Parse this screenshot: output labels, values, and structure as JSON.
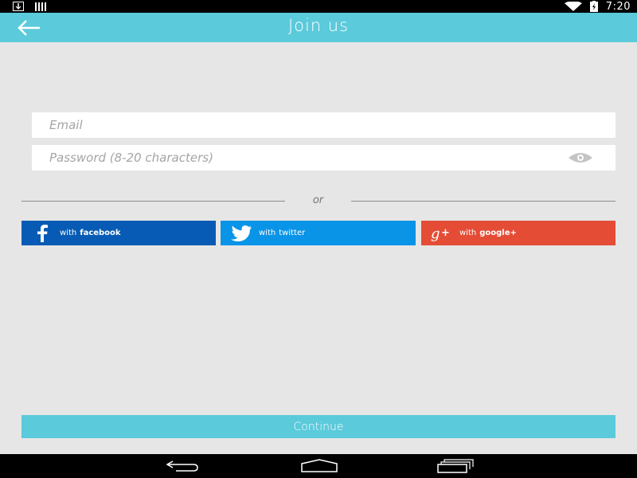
{
  "status_bar": {
    "time": "7:20",
    "left_icons": [
      "download-icon",
      "bars-icon"
    ],
    "right_icons": [
      "wifi-icon",
      "battery-charging-icon"
    ]
  },
  "app_bar": {
    "title": "Join us",
    "back_icon": "arrow-left-icon",
    "background": "#5bcadb"
  },
  "form": {
    "email_placeholder": "Email",
    "password_placeholder": "Password (8-20 characters)",
    "password_toggle_icon": "eye-icon"
  },
  "divider": {
    "text": "or"
  },
  "social": {
    "facebook": {
      "prefix": "with",
      "brand": "facebook",
      "icon": "facebook-icon",
      "color": "#075bb4"
    },
    "twitter": {
      "prefix": "with",
      "brand": "twitter",
      "icon": "twitter-icon",
      "color": "#0a94e8"
    },
    "google": {
      "prefix": "with",
      "brand": "google+",
      "icon": "google-plus-icon",
      "color": "#e44c36"
    }
  },
  "continue_label": "Continue",
  "nav_bar": {
    "icons": [
      "back-nav-icon",
      "home-nav-icon",
      "recent-apps-icon"
    ]
  }
}
